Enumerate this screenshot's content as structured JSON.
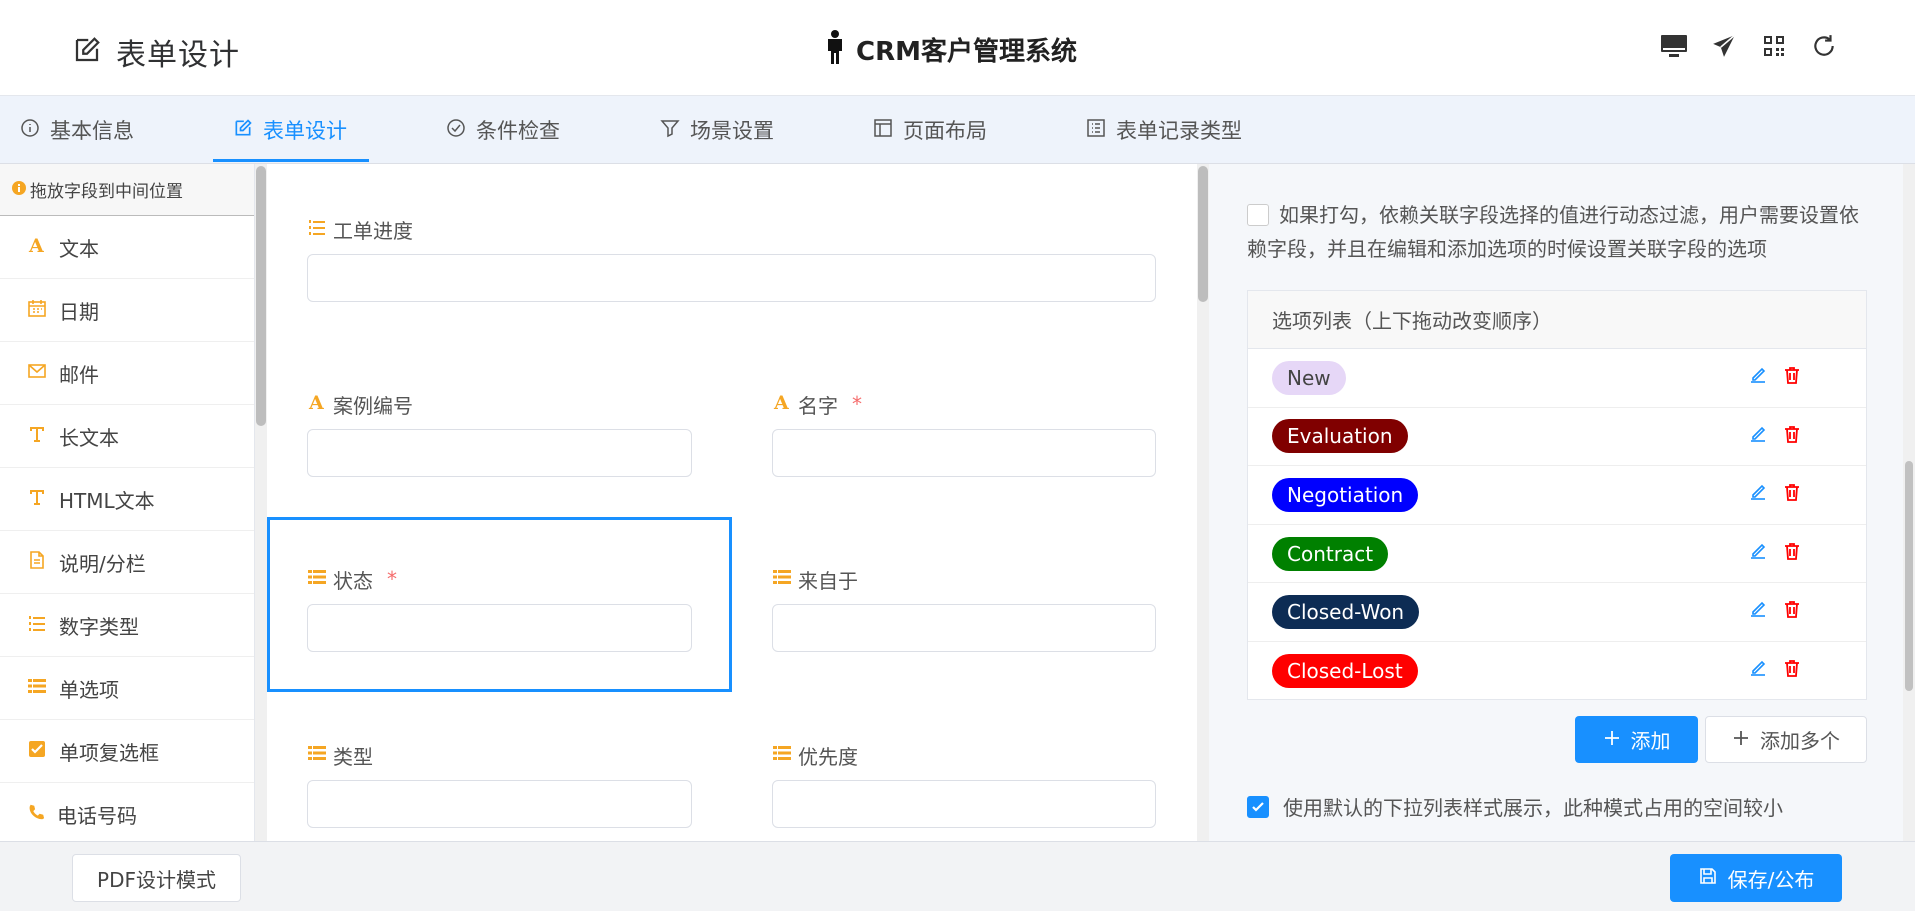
{
  "header": {
    "page_title": "表单设计",
    "app_name": "CRM客户管理系统",
    "icons": [
      "edit-icon",
      "person-icon",
      "monitor-icon",
      "send-icon",
      "qrcode-icon",
      "refresh-icon"
    ]
  },
  "tabs": [
    {
      "label": "基本信息",
      "icon": "info-icon"
    },
    {
      "label": "表单设计",
      "icon": "edit-icon",
      "active": true
    },
    {
      "label": "条件检查",
      "icon": "check-circle-icon"
    },
    {
      "label": "场景设置",
      "icon": "filter-icon"
    },
    {
      "label": "页面布局",
      "icon": "layout-icon"
    },
    {
      "label": "表单记录类型",
      "icon": "list-icon"
    }
  ],
  "palette": {
    "hint": "拖放字段到中间位置",
    "items": [
      {
        "label": "文本",
        "icon": "text-a-icon"
      },
      {
        "label": "日期",
        "icon": "calendar-icon"
      },
      {
        "label": "邮件",
        "icon": "mail-icon"
      },
      {
        "label": "长文本",
        "icon": "text-t-icon"
      },
      {
        "label": "HTML文本",
        "icon": "text-t-icon"
      },
      {
        "label": "说明/分栏",
        "icon": "document-icon"
      },
      {
        "label": "数字类型",
        "icon": "number-list-icon"
      },
      {
        "label": "单选项",
        "icon": "list-icon"
      },
      {
        "label": "单项复选框",
        "icon": "checkbox-icon"
      },
      {
        "label": "电话号码",
        "icon": "phone-icon"
      }
    ]
  },
  "canvas": {
    "fields": [
      {
        "label": "工单进度",
        "icon": "number-list-icon",
        "required": false
      },
      {
        "label": "案例编号",
        "icon": "text-a-icon",
        "required": false
      },
      {
        "label": "名字",
        "icon": "text-a-icon",
        "required": true
      },
      {
        "label": "状态",
        "icon": "list-icon",
        "required": true,
        "selected": true
      },
      {
        "label": "来自于",
        "icon": "list-icon",
        "required": false
      },
      {
        "label": "类型",
        "icon": "list-icon",
        "required": false
      },
      {
        "label": "优先度",
        "icon": "list-icon",
        "required": false
      }
    ],
    "required_mark": "*"
  },
  "properties": {
    "dependency_note": "如果打勾，依赖关联字段选择的值进行动态过滤，用户需要设置依赖字段，并且在编辑和添加选项的时候设置关联字段的选项",
    "dependency_checked": false,
    "option_list_title": "选项列表（上下拖动改变顺序）",
    "options": [
      {
        "label": "New",
        "bg": "#e6d7f7",
        "fg": "#444444"
      },
      {
        "label": "Evaluation",
        "bg": "#800000",
        "fg": "#ffffff"
      },
      {
        "label": "Negotiation",
        "bg": "#0000ff",
        "fg": "#ffffff"
      },
      {
        "label": "Contract",
        "bg": "#008000",
        "fg": "#ffffff"
      },
      {
        "label": "Closed-Won",
        "bg": "#0d2c54",
        "fg": "#ffffff"
      },
      {
        "label": "Closed-Lost",
        "bg": "#ff0000",
        "fg": "#ffffff"
      }
    ],
    "add_button": "添加",
    "add_multi_button": "添加多个",
    "dropdown_note": "使用默认的下拉列表样式展示，此种模式占用的空间较小",
    "dropdown_checked": true
  },
  "footer": {
    "pdf_button": "PDF设计模式",
    "save_button": "保存/公布"
  },
  "colors": {
    "accent": "#1890ff",
    "field_icon": "#f5a623",
    "danger": "#f56c6c"
  }
}
